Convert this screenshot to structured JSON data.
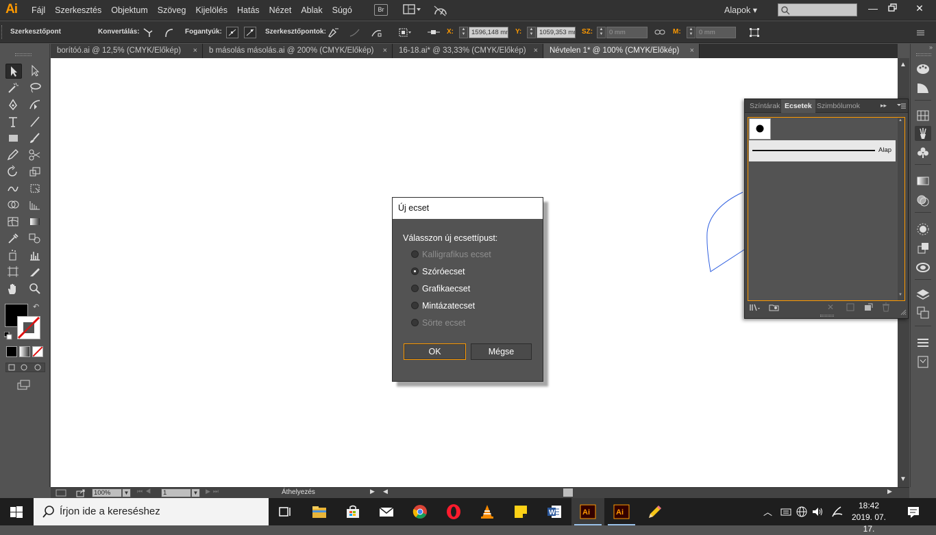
{
  "app": {
    "logo_text": "Ai",
    "brand_color": "#ff9a00"
  },
  "menu": [
    "Fájl",
    "Szerkesztés",
    "Objektum",
    "Szöveg",
    "Kijelölés",
    "Hatás",
    "Nézet",
    "Ablak",
    "Súgó"
  ],
  "titlebar": {
    "bridge_label": "Br",
    "workspace": "Alapok",
    "search_placeholder": ""
  },
  "control_bar": {
    "tool_name": "Szerkesztőpont",
    "convert_label": "Konvertálás:",
    "handles_label": "Fogantyúk:",
    "anchors_label": "Szerkesztőpontok:",
    "x_label": "X:",
    "x_value": "1596,148 mm",
    "y_label": "Y:",
    "y_value": "1059,353 mm",
    "w_label": "SZ:",
    "w_value": "0 mm",
    "h_label": "M:",
    "h_value": "0 mm"
  },
  "tabs": [
    {
      "label": "borítóó.ai @ 12,5% (CMYK/Előkép)",
      "close": "×"
    },
    {
      "label": "b másolás másolás.ai @ 200% (CMYK/Előkép)",
      "close": "×"
    },
    {
      "label": "16-18.ai* @ 33,33% (CMYK/Előkép)",
      "close": "×"
    },
    {
      "label": "Névtelen 1* @ 100% (CMYK/Előkép)",
      "close": "×"
    }
  ],
  "status_bar": {
    "zoom": "100%",
    "artboard": "1",
    "status_text": "Áthelyezés"
  },
  "brushes_panel": {
    "tabs": [
      "Színtárak",
      "Ecsetek",
      "Szimbólumok"
    ],
    "active_tab": "Ecsetek",
    "brush_name": "Alap"
  },
  "dialog": {
    "title": "Új ecset",
    "prompt": "Válasszon új ecsettípust:",
    "options": [
      {
        "label": "Kalligrafikus ecset",
        "enabled": false,
        "selected": false
      },
      {
        "label": "Szóróecset",
        "enabled": true,
        "selected": true
      },
      {
        "label": "Grafikaecset",
        "enabled": true,
        "selected": false
      },
      {
        "label": "Mintázatecset",
        "enabled": true,
        "selected": false
      },
      {
        "label": "Sörte ecset",
        "enabled": false,
        "selected": false
      }
    ],
    "ok_label": "OK",
    "cancel_label": "Mégse"
  },
  "taskbar": {
    "search_placeholder": "Írjon ide a kereséshez",
    "time": "18:42",
    "date": "2019. 07. 17.",
    "apps": [
      "task-view",
      "file-explorer",
      "store",
      "mail",
      "chrome",
      "opera",
      "vlc",
      "sticky-notes",
      "word",
      "illustrator",
      "illustrator-2",
      "paint"
    ]
  }
}
